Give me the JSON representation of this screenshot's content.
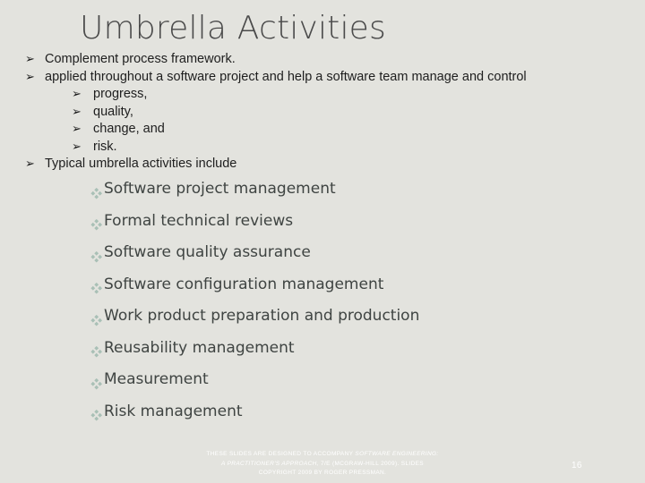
{
  "slide": {
    "title": "Umbrella Activities",
    "page_number": "16",
    "background_color": "#e3e3de",
    "title_color": "#4a4a4a",
    "body_text_color": "#1e1e1e",
    "diamond_text_color": "#3f4442",
    "diamond_bullet_color": "#a9c0b6",
    "footer_color": "#ffffff"
  },
  "arrow_bullets": [
    {
      "level": 1,
      "glyph": "➢",
      "text": "Complement process framework."
    },
    {
      "level": 1,
      "glyph": "➢",
      "text": "applied throughout a software project and help a software team manage and control"
    },
    {
      "level": 2,
      "glyph": "➢",
      "text": "progress,"
    },
    {
      "level": 2,
      "glyph": "➢",
      "text": "quality,"
    },
    {
      "level": 2,
      "glyph": "➢",
      "text": "change, and"
    },
    {
      "level": 2,
      "glyph": "➢",
      "text": "risk."
    },
    {
      "level": 1,
      "glyph": "➢",
      "text": "Typical umbrella activities include"
    }
  ],
  "diamond_bullets": [
    {
      "glyph": "diamond-bullet-icon",
      "text": "Software project management"
    },
    {
      "glyph": "diamond-bullet-icon",
      "text": "Formal technical reviews"
    },
    {
      "glyph": "diamond-bullet-icon",
      "text": "Software quality assurance"
    },
    {
      "glyph": "diamond-bullet-icon",
      "text": "Software configuration management"
    },
    {
      "glyph": "diamond-bullet-icon",
      "text": "Work product preparation and production"
    },
    {
      "glyph": "diamond-bullet-icon",
      "text": "Reusability management"
    },
    {
      "glyph": "diamond-bullet-icon",
      "text": "Measurement"
    },
    {
      "glyph": "diamond-bullet-icon",
      "text": "Risk management"
    }
  ],
  "footer": {
    "line1_part1": "These slides are designed to accompany ",
    "line1_em": "Software Engineering:",
    "line2_em": "A Practitioner's Approach,",
    "line2_part2": " 7/e (McGraw-Hill 2009). Slides",
    "line3": "copyright 2009 by Roger Pressman."
  }
}
